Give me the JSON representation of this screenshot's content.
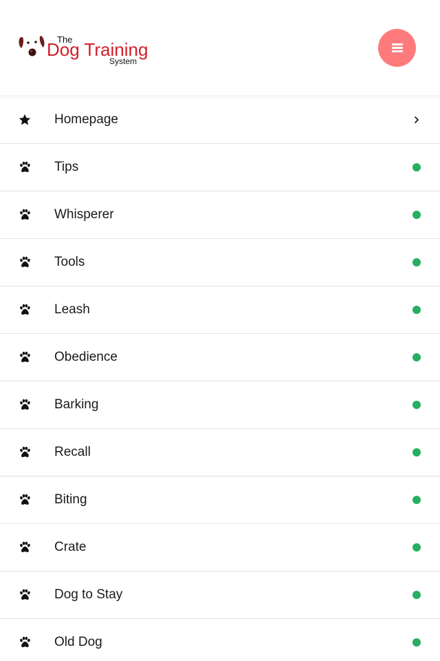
{
  "colors": {
    "accent": "#ff7b7b",
    "status_dot": "#27ae60",
    "brand_red": "#d21f2b",
    "text": "#1a1a1a"
  },
  "header": {
    "logo": {
      "line1": "The",
      "line2": "Dog Training",
      "line3": "System"
    },
    "menu_icon": "hamburger-icon"
  },
  "nav": {
    "items": [
      {
        "label": "Homepage",
        "icon": "star-icon",
        "end": "chevron-right-icon"
      },
      {
        "label": "Tips",
        "icon": "paw-icon",
        "end": "status-dot"
      },
      {
        "label": "Whisperer",
        "icon": "paw-icon",
        "end": "status-dot"
      },
      {
        "label": "Tools",
        "icon": "paw-icon",
        "end": "status-dot"
      },
      {
        "label": "Leash",
        "icon": "paw-icon",
        "end": "status-dot"
      },
      {
        "label": "Obedience",
        "icon": "paw-icon",
        "end": "status-dot"
      },
      {
        "label": "Barking",
        "icon": "paw-icon",
        "end": "status-dot"
      },
      {
        "label": "Recall",
        "icon": "paw-icon",
        "end": "status-dot"
      },
      {
        "label": "Biting",
        "icon": "paw-icon",
        "end": "status-dot"
      },
      {
        "label": "Crate",
        "icon": "paw-icon",
        "end": "status-dot"
      },
      {
        "label": "Dog to Stay",
        "icon": "paw-icon",
        "end": "status-dot"
      },
      {
        "label": "Old Dog",
        "icon": "paw-icon",
        "end": "status-dot"
      }
    ]
  }
}
